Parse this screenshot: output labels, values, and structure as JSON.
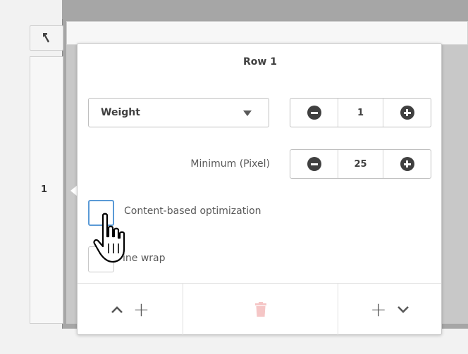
{
  "grid": {
    "undo_icon": "undo-icon",
    "row_header_label": "1"
  },
  "popover": {
    "title": "Row 1",
    "size_mode": {
      "selected": "Weight",
      "icon": "caret-down-icon"
    },
    "weight": {
      "value": "1",
      "decrement_icon": "minus-circle-icon",
      "increment_icon": "plus-circle-icon"
    },
    "minimum": {
      "label": "Minimum (Pixel)",
      "value": "25",
      "decrement_icon": "minus-circle-icon",
      "increment_icon": "plus-circle-icon"
    },
    "options": [
      {
        "label": "Content-based optimization",
        "checked": false,
        "focused": true
      },
      {
        "label": "ine wrap",
        "checked": false,
        "focused": false
      }
    ],
    "footer": {
      "insert_above_icons": [
        "chevron-up-icon",
        "plus-icon"
      ],
      "delete_icon": "trash-icon",
      "insert_below_icons": [
        "plus-icon",
        "chevron-down-icon"
      ]
    }
  },
  "colors": {
    "accent_focus": "#5a9ad6",
    "delete_disabled": "#f5c6c6",
    "text_primary": "#404040"
  }
}
